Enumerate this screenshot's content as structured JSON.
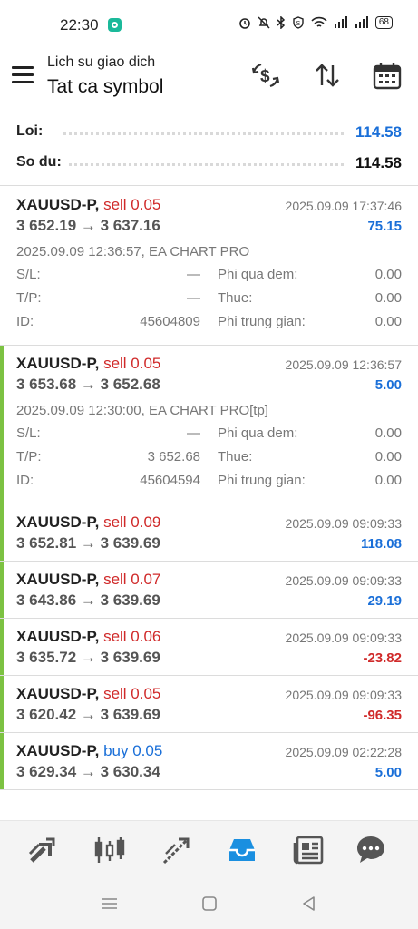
{
  "status_bar": {
    "time": "22:30",
    "battery": "68",
    "icons": [
      "alarm-icon",
      "bell-off-icon",
      "bluetooth-icon",
      "s-badge-icon",
      "wifi-icon",
      "signal-icon",
      "signal-icon",
      "battery-icon"
    ]
  },
  "appbar": {
    "subtitle": "Lich su giao dich",
    "title": "Tat ca symbol",
    "actions": [
      "currency-exchange-icon",
      "sort-icon",
      "calendar-icon"
    ]
  },
  "summary": {
    "profit_label": "Loi:",
    "profit_value": "114.58",
    "balance_label": "So du:",
    "balance_value": "114.58"
  },
  "deals": [
    {
      "symbol": "XAUUSD-P,",
      "side": "sell 0.05",
      "prices": "3 652.19 → 3 637.16",
      "time": "2025.09.09 17:37:46",
      "profit": "75.15",
      "profit_color": "#1a6fd8",
      "side_color": "#d02a2a",
      "accent": false,
      "expanded": true,
      "comment": "2025.09.09 12:36:57, EA CHART PRO",
      "sl_label": "S/L:",
      "sl_value": "—",
      "tp_label": "T/P:",
      "tp_value": "—",
      "id_label": "ID:",
      "id_value": "45604809",
      "swap_label": "Phi qua dem:",
      "swap_value": "0.00",
      "tax_label": "Thue:",
      "tax_value": "0.00",
      "commission_label": "Phi trung gian:",
      "commission_value": "0.00"
    },
    {
      "symbol": "XAUUSD-P,",
      "side": "sell 0.05",
      "prices": "3 653.68 → 3 652.68",
      "time": "2025.09.09 12:36:57",
      "profit": "5.00",
      "profit_color": "#1a6fd8",
      "side_color": "#d02a2a",
      "accent": true,
      "expanded": true,
      "comment": "2025.09.09 12:30:00, EA CHART PRO[tp]",
      "sl_label": "S/L:",
      "sl_value": "—",
      "tp_label": "T/P:",
      "tp_value": "3 652.68",
      "id_label": "ID:",
      "id_value": "45604594",
      "swap_label": "Phi qua dem:",
      "swap_value": "0.00",
      "tax_label": "Thue:",
      "tax_value": "0.00",
      "commission_label": "Phi trung gian:",
      "commission_value": "0.00"
    },
    {
      "symbol": "XAUUSD-P,",
      "side": "sell 0.09",
      "prices": "3 652.81 → 3 639.69",
      "time": "2025.09.09 09:09:33",
      "profit": "118.08",
      "profit_color": "#1a6fd8",
      "side_color": "#d02a2a",
      "accent": true,
      "expanded": false
    },
    {
      "symbol": "XAUUSD-P,",
      "side": "sell 0.07",
      "prices": "3 643.86 → 3 639.69",
      "time": "2025.09.09 09:09:33",
      "profit": "29.19",
      "profit_color": "#1a6fd8",
      "side_color": "#d02a2a",
      "accent": true,
      "expanded": false
    },
    {
      "symbol": "XAUUSD-P,",
      "side": "sell 0.06",
      "prices": "3 635.72 → 3 639.69",
      "time": "2025.09.09 09:09:33",
      "profit": "-23.82",
      "profit_color": "#d02a2a",
      "side_color": "#d02a2a",
      "accent": true,
      "expanded": false
    },
    {
      "symbol": "XAUUSD-P,",
      "side": "sell 0.05",
      "prices": "3 620.42 → 3 639.69",
      "time": "2025.09.09 09:09:33",
      "profit": "-96.35",
      "profit_color": "#d02a2a",
      "side_color": "#d02a2a",
      "accent": true,
      "expanded": false
    },
    {
      "symbol": "XAUUSD-P,",
      "side": "buy 0.05",
      "prices": "3 629.34 → 3 630.34",
      "time": "2025.09.09 02:22:28",
      "profit": "5.00",
      "profit_color": "#1a6fd8",
      "side_color": "#1a6fd8",
      "accent": true,
      "expanded": false
    }
  ],
  "bottom_nav": {
    "items": [
      "quotes-icon",
      "chart-icon",
      "trade-icon",
      "history-icon",
      "news-icon",
      "chat-icon"
    ],
    "active": "history-icon",
    "active_color": "#1a8fe0"
  },
  "system_nav": [
    "menu-icon",
    "home-icon",
    "back-icon"
  ]
}
